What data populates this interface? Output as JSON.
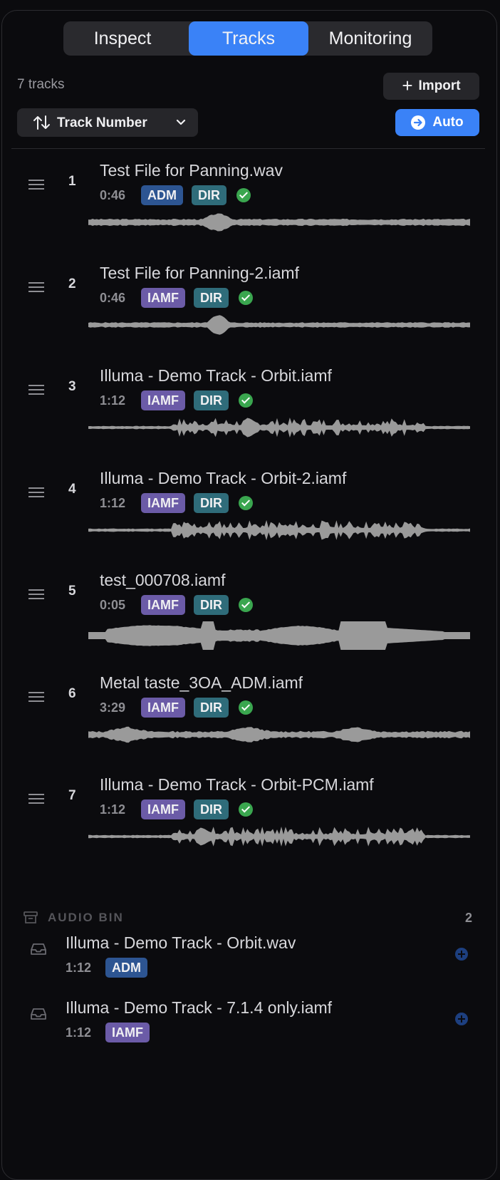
{
  "tabs": [
    {
      "label": "Inspect",
      "active": false
    },
    {
      "label": "Tracks",
      "active": true
    },
    {
      "label": "Monitoring",
      "active": false
    }
  ],
  "toolbar": {
    "track_count": "7 tracks",
    "import_label": "Import",
    "sort_label": "Track Number",
    "auto_label": "Auto"
  },
  "tracks": [
    {
      "number": "1",
      "title": "Test File for Panning.wav",
      "duration": "0:46",
      "format": "ADM",
      "mode": "DIR",
      "status": "ok"
    },
    {
      "number": "2",
      "title": "Test File for Panning-2.iamf",
      "duration": "0:46",
      "format": "IAMF",
      "mode": "DIR",
      "status": "ok"
    },
    {
      "number": "3",
      "title": "Illuma - Demo Track - Orbit.iamf",
      "duration": "1:12",
      "format": "IAMF",
      "mode": "DIR",
      "status": "ok"
    },
    {
      "number": "4",
      "title": "Illuma - Demo Track - Orbit-2.iamf",
      "duration": "1:12",
      "format": "IAMF",
      "mode": "DIR",
      "status": "ok"
    },
    {
      "number": "5",
      "title": "test_000708.iamf",
      "duration": "0:05",
      "format": "IAMF",
      "mode": "DIR",
      "status": "ok"
    },
    {
      "number": "6",
      "title": "Metal taste_3OA_ADM.iamf",
      "duration": "3:29",
      "format": "IAMF",
      "mode": "DIR",
      "status": "ok"
    },
    {
      "number": "7",
      "title": "Illuma - Demo Track - Orbit-PCM.iamf",
      "duration": "1:12",
      "format": "IAMF",
      "mode": "DIR",
      "status": "ok"
    }
  ],
  "audio_bin": {
    "title": "AUDIO BIN",
    "count": "2",
    "items": [
      {
        "title": "Illuma - Demo Track - Orbit.wav",
        "duration": "1:12",
        "format": "ADM"
      },
      {
        "title": "Illuma - Demo Track - 7.1.4 only.iamf",
        "duration": "1:12",
        "format": "IAMF"
      }
    ]
  },
  "colors": {
    "accent": "#3a82f7",
    "badge_adm": "#2d5592",
    "badge_iamf": "#6b5ba7",
    "badge_dir": "#2f6c7a",
    "status_ok": "#3aa64f",
    "waveform": "#9a9a9a"
  },
  "icons": [
    "sort-arrows-icon",
    "chevron-down-icon",
    "plus-icon",
    "auto-arrow-icon",
    "drag-handle-icon",
    "check-icon",
    "archive-box-icon",
    "tray-icon",
    "add-circle-icon"
  ]
}
